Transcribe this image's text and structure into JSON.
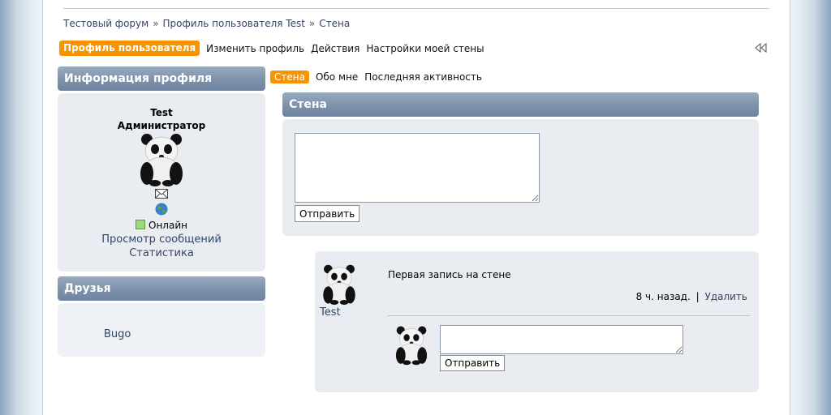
{
  "breadcrumb": {
    "items": [
      "Тестовый форум",
      "Профиль пользователя Test",
      "Стена"
    ],
    "separator": "»"
  },
  "nav": {
    "active_tab": "Профиль пользователя",
    "tabs": [
      "Изменить профиль",
      "Действия",
      "Настройки моей стены"
    ]
  },
  "profile": {
    "header": "Информация профиля",
    "username": "Test",
    "role": "Администратор",
    "online_label": "Онлайн",
    "view_posts": "Просмотр сообщений",
    "stats": "Статистика"
  },
  "friends": {
    "header": "Друзья",
    "items": [
      "Bugo"
    ]
  },
  "subtabs": {
    "active": "Стена",
    "items": [
      "Обо мне",
      "Последняя активность"
    ]
  },
  "wall": {
    "header": "Стена",
    "submit_label": "Отправить",
    "post": {
      "author": "Test",
      "text": "Первая запись на стене",
      "time": "8 ч. назад.",
      "sep": "|",
      "delete_label": "Удалить",
      "reply_submit": "Отправить"
    }
  },
  "colors": {
    "accent": "#f79400",
    "header": "#7d91aa",
    "panel": "#e9edf2",
    "link": "#334466"
  }
}
